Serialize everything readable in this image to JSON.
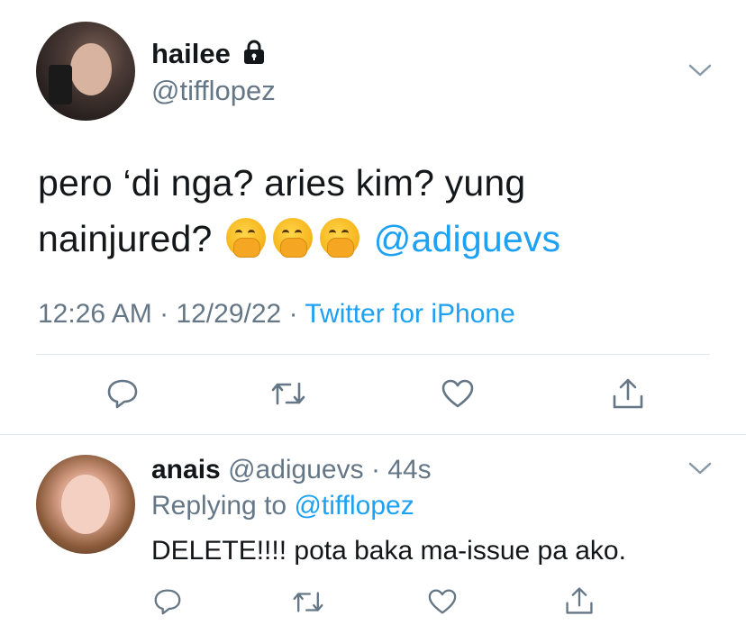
{
  "tweet": {
    "author_name": "hailee",
    "author_handle": "@tifflopez",
    "text_line1": "pero ‘di nga? aries kim? yung",
    "text_line2_prefix": "nainjured?",
    "emojis": [
      "face-with-hand-over-mouth",
      "face-with-hand-over-mouth",
      "face-with-hand-over-mouth"
    ],
    "mention": "@adiguevs",
    "time": "12:26 AM",
    "date": "12/29/22",
    "source": "Twitter for iPhone",
    "actions": [
      "reply-icon",
      "retweet-icon",
      "like-icon",
      "share-icon"
    ]
  },
  "reply": {
    "author_name": "anais",
    "author_handle": "@adiguevs",
    "age": "44s",
    "replying_label": "Replying to",
    "replying_to": "@tifflopez",
    "text": "DELETE!!!! pota baka ma-issue pa ako.",
    "actions": [
      "reply-icon",
      "retweet-icon",
      "like-icon",
      "share-icon"
    ]
  },
  "colors": {
    "text": "#14171a",
    "secondary": "#657786",
    "link": "#1da1f2",
    "divider": "#e1e8ed"
  }
}
